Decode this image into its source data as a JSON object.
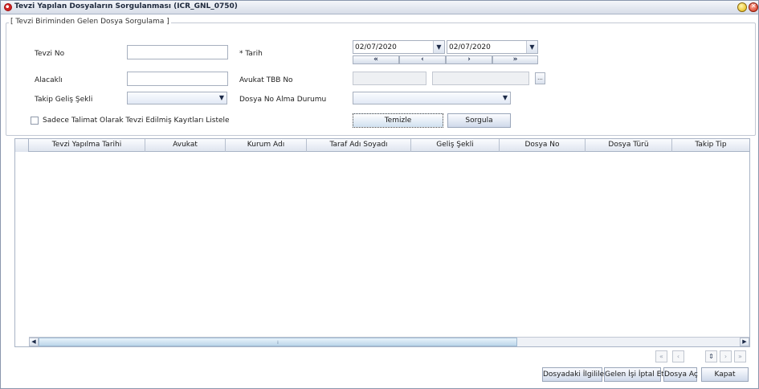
{
  "window": {
    "title": "Tevzi Yapılan Dosyaların Sorgulanması (ICR_GNL_0750)"
  },
  "form": {
    "legend": "[ Tevzi Biriminden Gelen Dosya Sorgulama ]",
    "tevzi_no_label": "Tevzi No",
    "tevzi_no_value": "",
    "alacakli_label": "Alacaklı",
    "alacakli_value": "",
    "takip_gelis_label": "Takip Geliş Şekli",
    "takip_gelis_value": "",
    "tarih_label": "* Tarih",
    "date_from": "02/07/2020",
    "date_to": "02/07/2020",
    "nav_first": "«",
    "nav_prev": "‹",
    "nav_next": "›",
    "nav_last": "»",
    "avukat_tbb_label": "Avukat TBB No",
    "avukat_tbb_value": "",
    "avukat_tbb_name": "",
    "lookup_label": "...",
    "dosya_no_alma_label": "Dosya No Alma Durumu",
    "dosya_no_alma_value": "",
    "sadece_talimat_label": "Sadece Talimat Olarak Tevzi Edilmiş Kayıtları Listele",
    "sadece_talimat_checked": false,
    "temizle_label": "Temizle",
    "sorgula_label": "Sorgula"
  },
  "table": {
    "columns": [
      "Tevzi Yapılma Tarihi",
      "Avukat",
      "Kurum Adı",
      "Taraf Adı Soyadı",
      "Geliş Şekli",
      "Dosya No",
      "Dosya Türü",
      "Takip Tip"
    ],
    "rows": []
  },
  "pager": {
    "first": "«",
    "prev": "‹",
    "stepper": "⇕",
    "next": "›",
    "last": "»"
  },
  "footer": {
    "dosyadaki_ilgililer": "Dosyadaki İlgililer",
    "gelen_isi_iptal": "Gelen İşi İptal Et",
    "dosya_ac": "Dosya Aç",
    "kapat": "Kapat"
  }
}
